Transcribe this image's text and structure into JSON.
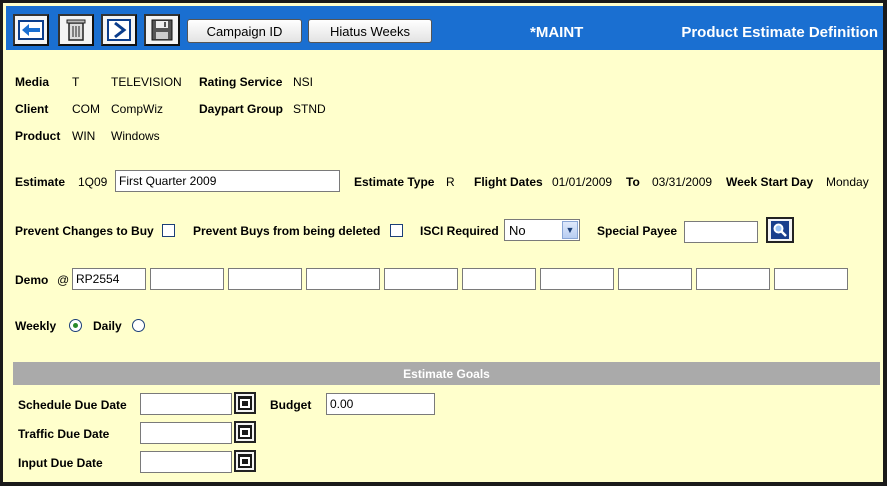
{
  "toolbar": {
    "campaign_label": "Campaign ID",
    "hiatus_label": "Hiatus Weeks",
    "maint_text": "*MAINT",
    "title": "Product Estimate Definition",
    "accent": "#1a6fd1"
  },
  "header_info": {
    "media_label": "Media",
    "media_code": "T",
    "media_name": "TELEVISION",
    "client_label": "Client",
    "client_code": "COM",
    "client_name": "CompWiz",
    "product_label": "Product",
    "product_code": "WIN",
    "product_name": "Windows",
    "rating_label": "Rating Service",
    "rating_value": "NSI",
    "daypart_label": "Daypart Group",
    "daypart_value": "STND"
  },
  "estimate": {
    "label": "Estimate",
    "code": "1Q09",
    "name": "First Quarter 2009",
    "type_label": "Estimate Type",
    "type_value": "R",
    "flight_label": "Flight Dates",
    "flight_start": "01/01/2009",
    "to_label": "To",
    "flight_end": "03/31/2009",
    "week_label": "Week Start Day",
    "week_value": "Monday"
  },
  "options": {
    "prevent_changes_label": "Prevent Changes to Buy",
    "prevent_delete_label": "Prevent Buys from being deleted",
    "isci_label": "ISCI Required",
    "isci_value": "No",
    "payee_label": "Special Payee",
    "payee_value": ""
  },
  "demo": {
    "label": "Demo",
    "at": "@",
    "values": [
      "RP2554",
      "",
      "",
      "",
      "",
      "",
      "",
      "",
      "",
      ""
    ]
  },
  "frequency": {
    "weekly_label": "Weekly",
    "daily_label": "Daily",
    "selected": "Weekly"
  },
  "goals": {
    "section_title": "Estimate Goals",
    "schedule_label": "Schedule Due Date",
    "schedule_value": "",
    "traffic_label": "Traffic Due Date",
    "traffic_value": "",
    "input_label": "Input Due Date",
    "input_value": "",
    "budget_label": "Budget",
    "budget_value": "0.00"
  }
}
